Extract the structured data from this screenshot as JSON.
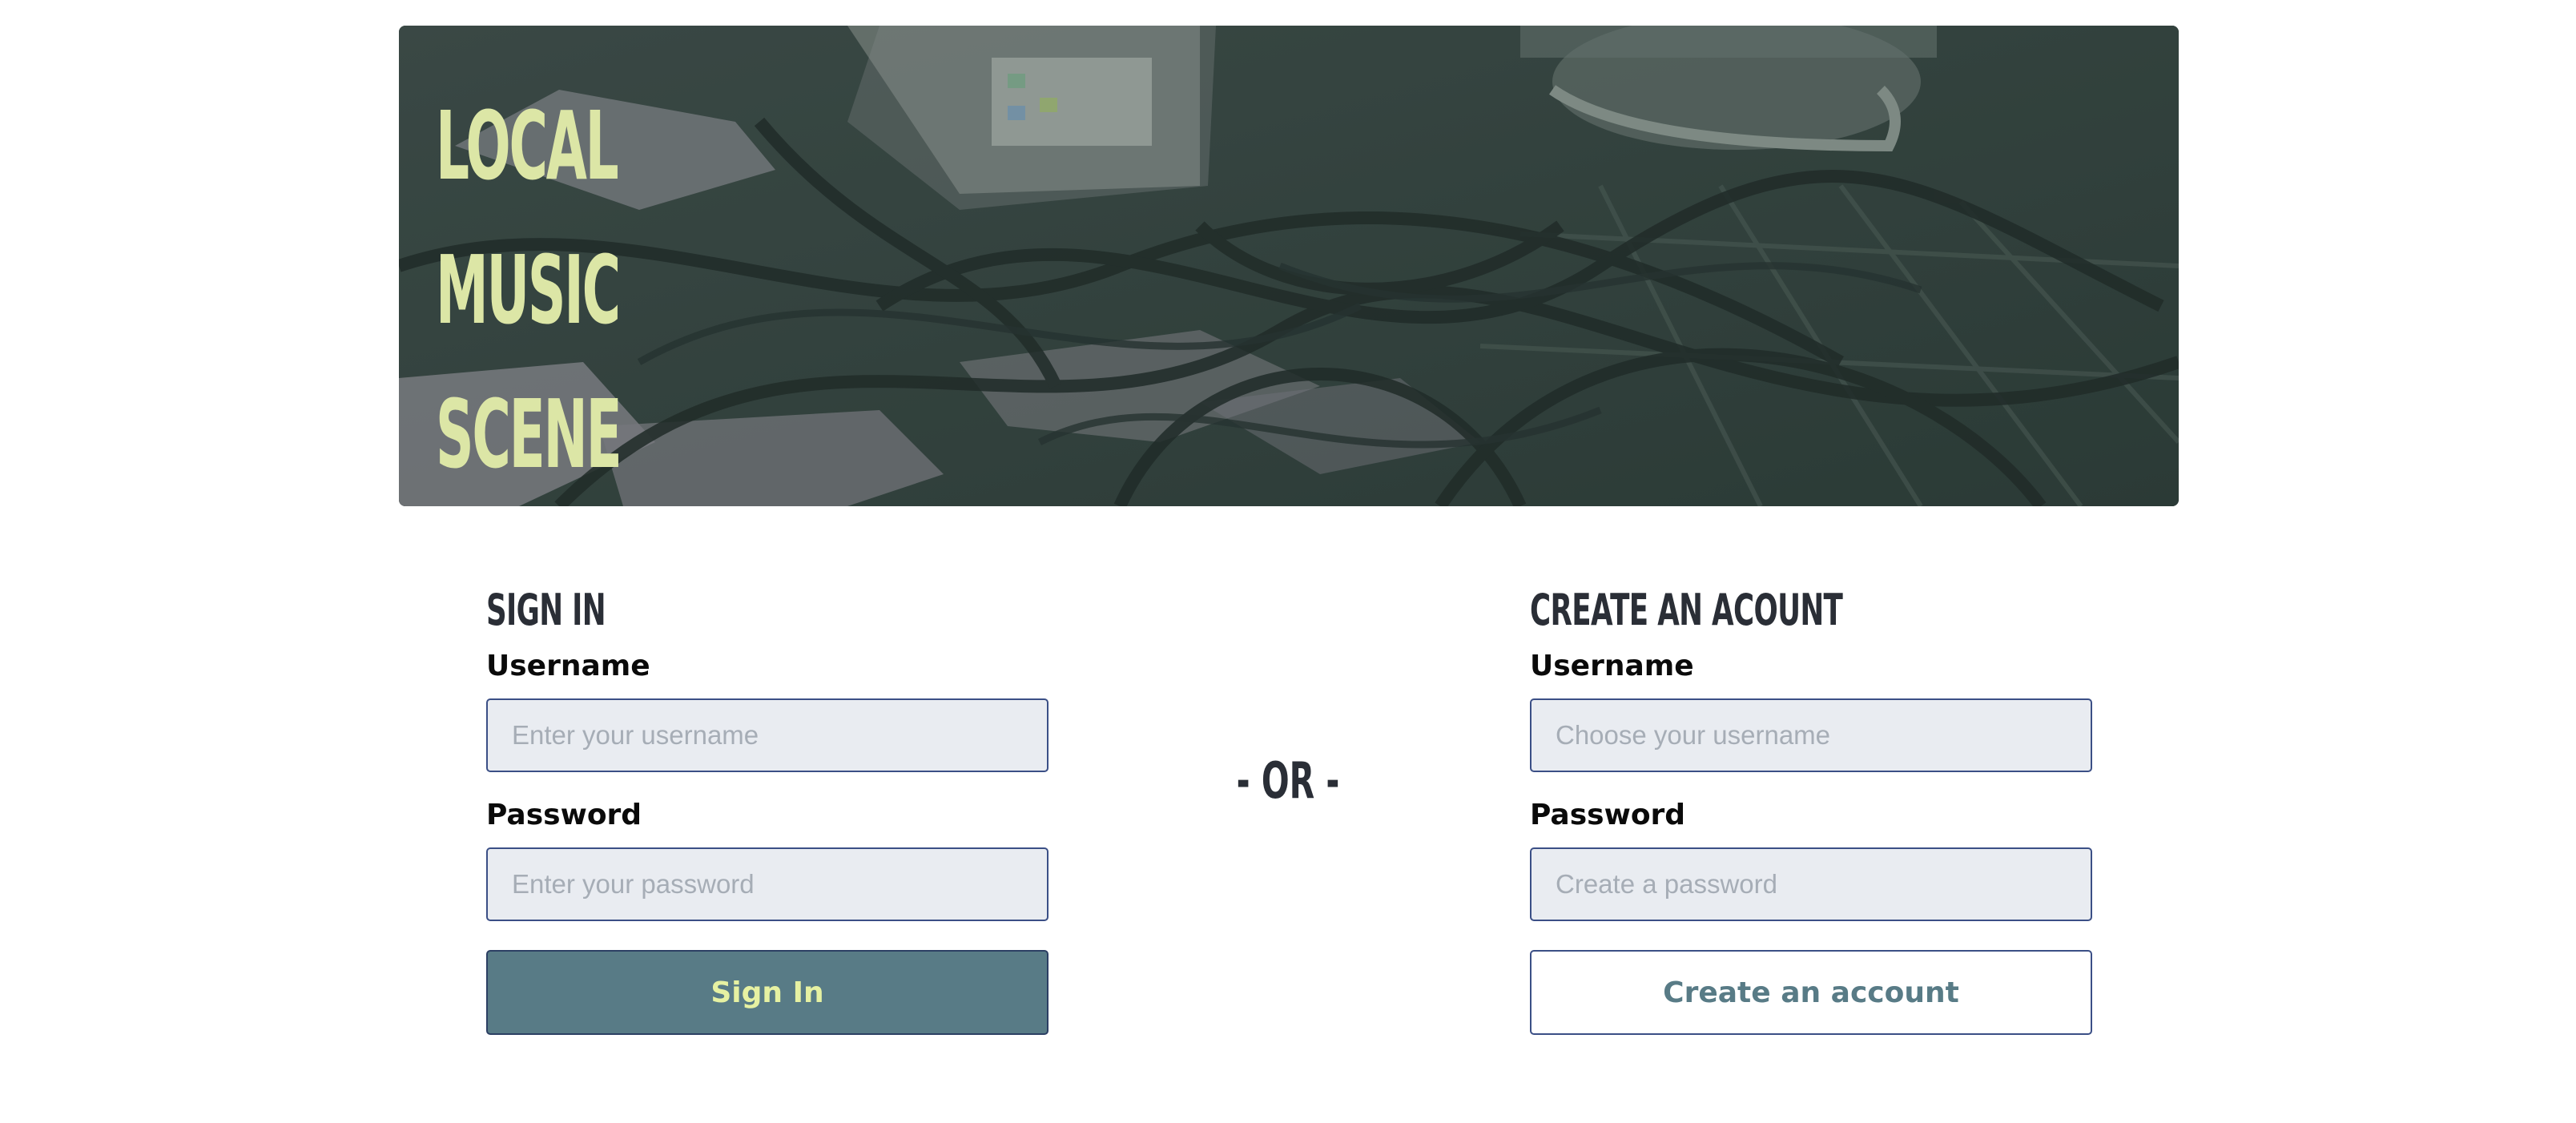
{
  "hero": {
    "title_lines": [
      "LOCAL",
      "MUSIC",
      "SCENE"
    ],
    "image": "stage-floor-cables-photo",
    "title_color": "#dce6a6"
  },
  "sign_in": {
    "heading": "SIGN IN",
    "username_label": "Username",
    "username_placeholder": "Enter your username",
    "password_label": "Password",
    "password_placeholder": "Enter your password",
    "button_label": "Sign In"
  },
  "divider": {
    "label": "- OR -"
  },
  "create_account": {
    "heading": "CREATE AN ACOUNT",
    "username_label": "Username",
    "username_placeholder": "Choose your username",
    "password_label": "Password",
    "password_placeholder": "Create a password",
    "button_label": "Create an account"
  },
  "colors": {
    "primary_button_bg": "#587b86",
    "primary_button_text": "#e6f1a2",
    "input_bg": "#e9ecf1",
    "input_border": "#3b4f86",
    "heading_text": "#2a2e36"
  }
}
